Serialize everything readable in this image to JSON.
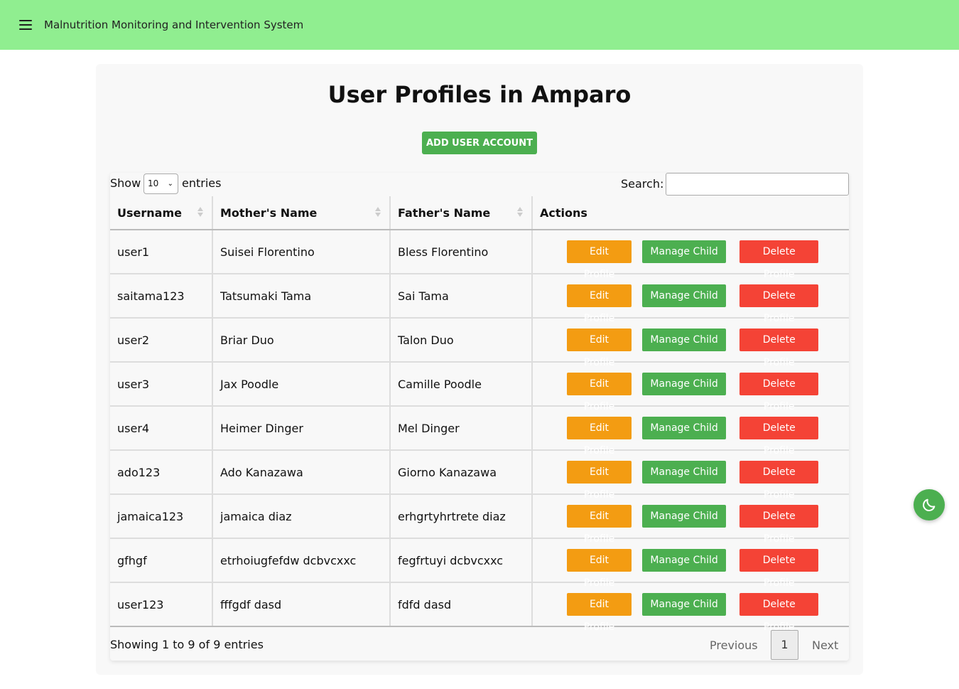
{
  "header": {
    "app_title": "Malnutrition Monitoring and Intervention System"
  },
  "page": {
    "title": "User Profiles in Amparo",
    "add_button": "ADD USER ACCOUNT"
  },
  "table_controls": {
    "show_label": "Show",
    "page_length": "10",
    "entries_label": "entries",
    "search_label": "Search:",
    "search_value": ""
  },
  "columns": [
    "Username",
    "Mother's Name",
    "Father's Name",
    "Actions"
  ],
  "actions": {
    "edit": "Edit Profile",
    "manage": "Manage Child",
    "delete": "Delete Profile"
  },
  "rows": [
    {
      "username": "user1",
      "mother": "Suisei Florentino",
      "father": "Bless Florentino"
    },
    {
      "username": "saitama123",
      "mother": "Tatsumaki Tama",
      "father": "Sai Tama"
    },
    {
      "username": "user2",
      "mother": "Briar Duo",
      "father": "Talon Duo"
    },
    {
      "username": "user3",
      "mother": "Jax Poodle",
      "father": "Camille Poodle"
    },
    {
      "username": "user4",
      "mother": "Heimer Dinger",
      "father": "Mel Dinger"
    },
    {
      "username": "ado123",
      "mother": "Ado Kanazawa",
      "father": "Giorno Kanazawa"
    },
    {
      "username": "jamaica123",
      "mother": "jamaica diaz",
      "father": "erhgrtyhrtrete diaz"
    },
    {
      "username": "gfhgf",
      "mother": "etrhoiugfefdw dcbvcxxc",
      "father": "fegfrtuyi dcbvcxxc"
    },
    {
      "username": "user123",
      "mother": "fffgdf dasd",
      "father": "fdfd dasd"
    }
  ],
  "footer": {
    "info": "Showing 1 to 9 of 9 entries",
    "previous": "Previous",
    "current_page": "1",
    "next": "Next"
  },
  "icons": {
    "menu": "hamburger-menu-icon",
    "theme": "moon-icon"
  },
  "colors": {
    "header_bg": "#90ee90",
    "accent_green": "#4caf50",
    "edit_orange": "#f39c12",
    "delete_red": "#f44336"
  }
}
